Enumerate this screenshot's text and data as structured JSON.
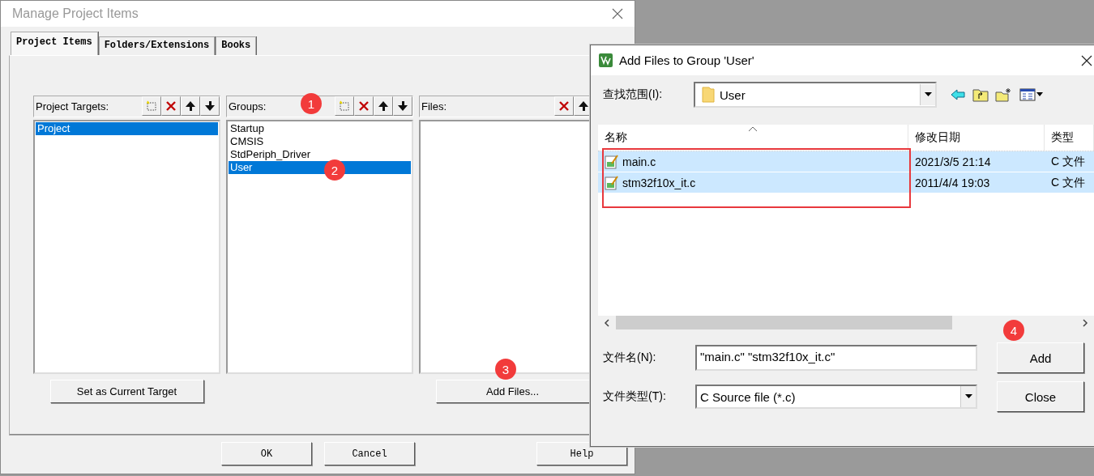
{
  "main_dialog": {
    "title": "Manage Project Items",
    "tabs": [
      {
        "label": "Project Items",
        "selected": true
      },
      {
        "label": "Folders/Extensions",
        "selected": false
      },
      {
        "label": "Books",
        "selected": false
      }
    ],
    "panels": [
      {
        "label": "Project Targets:",
        "items": [
          {
            "text": "Project",
            "selected": true
          }
        ],
        "button": "Set as Current Target"
      },
      {
        "label": "Groups:",
        "items": [
          {
            "text": "Startup",
            "selected": false
          },
          {
            "text": "CMSIS",
            "selected": false
          },
          {
            "text": "StdPeriph_Driver",
            "selected": false
          },
          {
            "text": "User",
            "selected": true
          }
        ]
      },
      {
        "label": "Files:",
        "button": "Add Files..."
      }
    ],
    "buttons": [
      "OK",
      "Cancel",
      "Help"
    ]
  },
  "file_dialog": {
    "title": "Add Files to Group 'User'",
    "look_in": {
      "label": "查找范围(I):",
      "value": "User"
    },
    "columns": [
      "名称",
      "修改日期",
      "类型"
    ],
    "rows": [
      {
        "name": "main.c",
        "date": "2021/3/5 21:14",
        "type": "C 文件",
        "selected": true
      },
      {
        "name": "stm32f10x_it.c",
        "date": "2011/4/4 19:03",
        "type": "C 文件",
        "selected": true
      }
    ],
    "file_name": {
      "label": "文件名(N):",
      "value": "\"main.c\" \"stm32f10x_it.c\""
    },
    "file_type": {
      "label": "文件类型(T):",
      "value": "C Source file (*.c)"
    },
    "buttons": [
      "Add",
      "Close"
    ]
  },
  "annotations": [
    "1",
    "2",
    "3",
    "4"
  ]
}
